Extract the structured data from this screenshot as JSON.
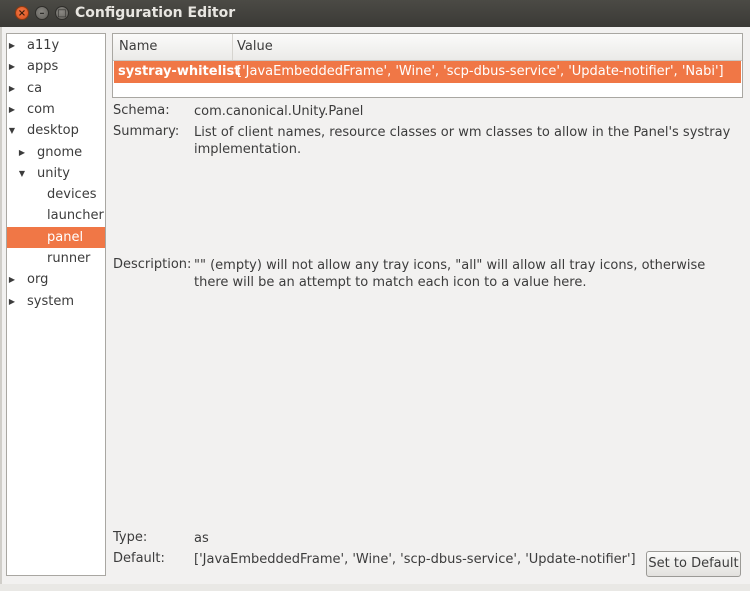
{
  "window": {
    "title": "Configuration Editor"
  },
  "tree": [
    {
      "label": "a11y",
      "arrow": "▶",
      "depth": 0,
      "selected": false
    },
    {
      "label": "apps",
      "arrow": "▶",
      "depth": 0,
      "selected": false
    },
    {
      "label": "ca",
      "arrow": "▶",
      "depth": 0,
      "selected": false
    },
    {
      "label": "com",
      "arrow": "▶",
      "depth": 0,
      "selected": false
    },
    {
      "label": "desktop",
      "arrow": "▼",
      "depth": 0,
      "selected": false
    },
    {
      "label": "gnome",
      "arrow": "▶",
      "depth": 1,
      "selected": false
    },
    {
      "label": "unity",
      "arrow": "▼",
      "depth": 1,
      "selected": false
    },
    {
      "label": "devices",
      "arrow": "",
      "depth": 2,
      "selected": false
    },
    {
      "label": "launcher",
      "arrow": "",
      "depth": 2,
      "selected": false
    },
    {
      "label": "panel",
      "arrow": "",
      "depth": 2,
      "selected": true
    },
    {
      "label": "runner",
      "arrow": "",
      "depth": 2,
      "selected": false
    },
    {
      "label": "org",
      "arrow": "▶",
      "depth": 0,
      "selected": false
    },
    {
      "label": "system",
      "arrow": "▶",
      "depth": 0,
      "selected": false
    }
  ],
  "table": {
    "headers": {
      "name": "Name",
      "value": "Value"
    },
    "rows": [
      {
        "key": "systray-whitelist",
        "value": "['JavaEmbeddedFrame', 'Wine', 'scp-dbus-service', 'Update-notifier', 'Nabi']"
      }
    ]
  },
  "details": {
    "schema_label": "Schema:",
    "schema": "com.canonical.Unity.Panel",
    "summary_label": "Summary:",
    "summary": "List of client names, resource classes or wm classes to allow in the Panel's systray implementation.",
    "description_label": "Description:",
    "description": "\"\" (empty) will not allow any tray icons, \"all\" will allow all tray icons, otherwise there will be an attempt to match each icon to a value here.",
    "type_label": "Type:",
    "type": "as",
    "default_label": "Default:",
    "default": "['JavaEmbeddedFrame', 'Wine', 'scp-dbus-service', 'Update-notifier']"
  },
  "buttons": {
    "set_default": "Set to Default"
  },
  "colors": {
    "accent": "#f07746",
    "titlebar": "#3c3b37"
  }
}
